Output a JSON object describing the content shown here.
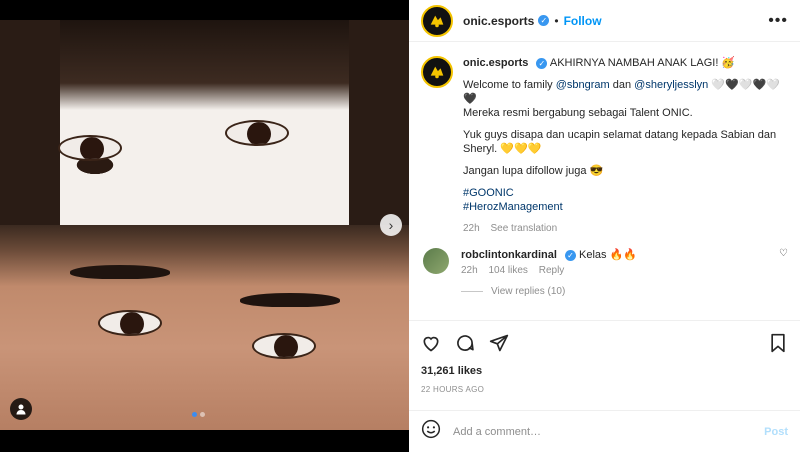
{
  "post": {
    "author": "onic.esports",
    "follow_label": "Follow",
    "separator": "•",
    "more_label": "•••",
    "caption": {
      "title": "AKHIRNYA NAMBAH ANAK LAGI! 🥳",
      "line1_prefix": "Welcome to family",
      "mention1": "@sbngram",
      "and_word": "dan",
      "mention2": "@sheryljesslyn",
      "line1_suffix": "🤍🖤🤍🖤🤍🖤",
      "line2": "Mereka resmi bergabung sebagai Talent ONIC.",
      "line3": "Yuk guys disapa dan ucapin selamat datang kepada Sabian dan Sheryl. 💛💛💛",
      "line4": "Jangan lupa difollow juga 😎",
      "hashtag1": "#GOONIC",
      "hashtag2": "#HerozManagement",
      "time": "22h",
      "see_translation": "See translation"
    },
    "comment": {
      "author": "robclintonkardinal",
      "text": "Kelas 🔥🔥",
      "time": "22h",
      "likes": "104 likes",
      "reply": "Reply",
      "view_replies": "View replies (10)"
    },
    "likes_count": "31,261 likes",
    "timestamp": "22 HOURS AGO",
    "add_comment_placeholder": "Add a comment…",
    "post_button": "Post"
  },
  "carousel": {
    "current_index": 1,
    "total": 2,
    "next_arrow": "›"
  },
  "colors": {
    "follow_blue": "#0095f6",
    "verified_blue": "#3897f0",
    "brand_yellow": "#f4c400",
    "post_disabled": "#b2dffc"
  },
  "icons": [
    "verified-icon",
    "more-options-icon",
    "heart-icon",
    "comment-icon",
    "share-icon",
    "save-icon",
    "emoji-icon",
    "user-tag-icon",
    "next-arrow-icon"
  ]
}
